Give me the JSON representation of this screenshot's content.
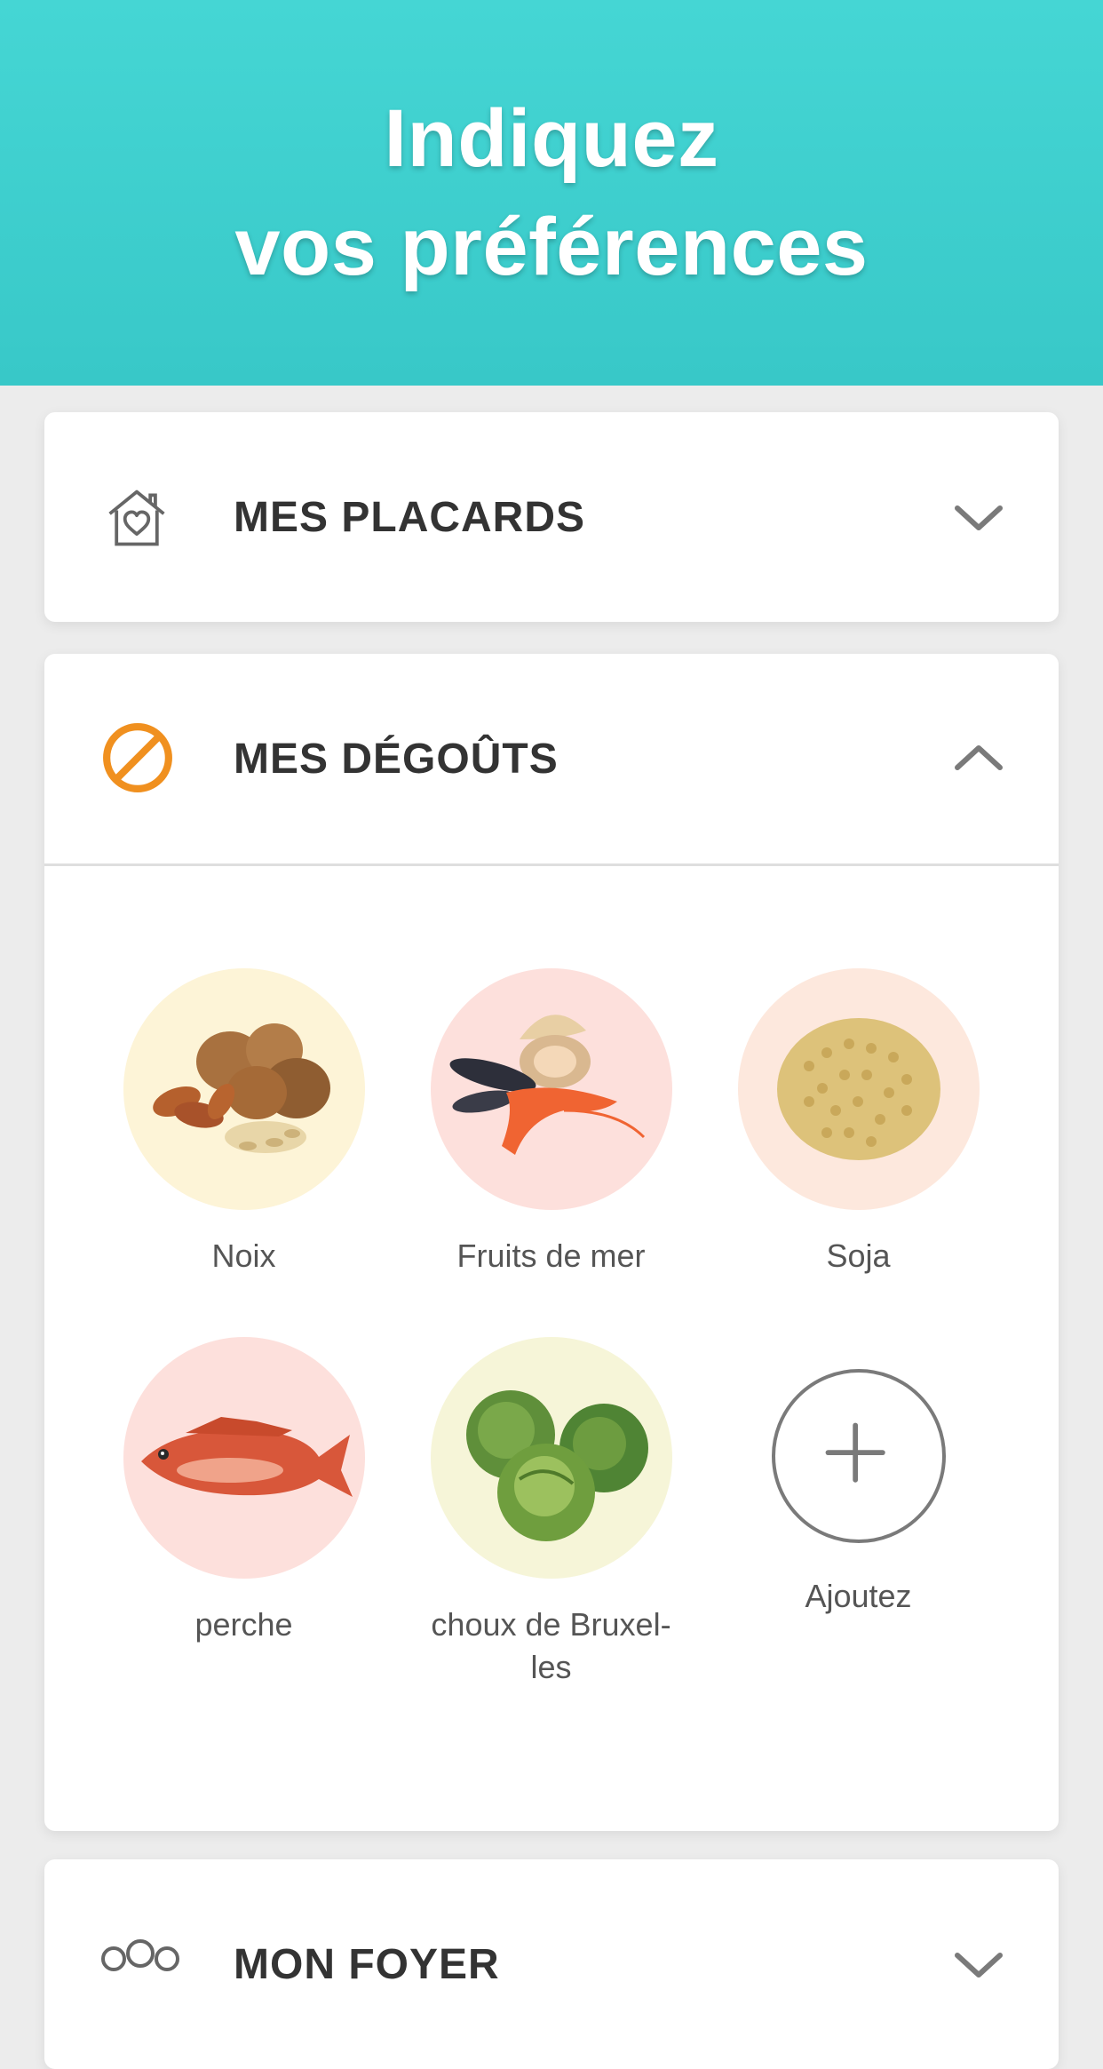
{
  "header": {
    "title_line1": "Indiquez",
    "title_line2": "vos préférences"
  },
  "sections": {
    "placards": {
      "title": "MES PLACARDS",
      "icon": "house-heart-icon",
      "state": "collapsed"
    },
    "degouts": {
      "title": "MES DÉGOÛTS",
      "icon": "prohibited-icon",
      "state": "expanded"
    },
    "foyer": {
      "title": "MON FOYER",
      "icon": "people-icon",
      "state": "collapsed"
    }
  },
  "dislikes": [
    {
      "label": "Noix",
      "bg": "#fdf4d7",
      "icon": "nuts-image"
    },
    {
      "label": "Fruits de mer",
      "bg": "#fde0dc",
      "icon": "seafood-image"
    },
    {
      "label": "Soja",
      "bg": "#fde8dd",
      "icon": "soy-image"
    },
    {
      "label": "perche",
      "bg": "#fde0dc",
      "icon": "fish-image"
    },
    {
      "label": "choux de Bruxel-\nles",
      "bg": "#f6f5d8",
      "icon": "brussels-sprouts-image"
    }
  ],
  "add": {
    "label": "Ajoutez",
    "icon": "plus-icon"
  },
  "colors": {
    "header": "#3ccfcd",
    "accent_orange": "#f0901f",
    "icon_gray": "#666666"
  }
}
